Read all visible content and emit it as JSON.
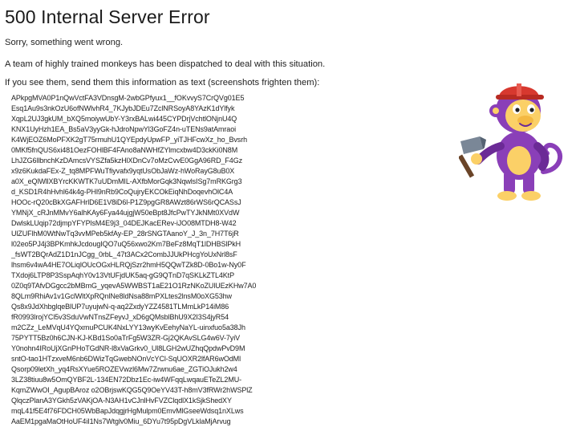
{
  "error": {
    "title": "500 Internal Server Error",
    "line1": "Sorry, something went wrong.",
    "line2": "A team of highly trained monkeys has been dispatched to deal with this situation.",
    "line3": "If you see them, send them this information as text (screenshots frighten them):"
  },
  "trace_lines": [
    "APkpgMVA0P1nQwVctFA3VDnsgM-2wbGPfyux1__fOKvvyS7CrQVg01E5",
    "Esq1Au9s3nkOzU6ofNWlvhR4_7KJybJDEu7ZclNRSoyA8YAzK1dYlfyk",
    "XqpL2UJ3gkUM_bXQ5moiywUbY-Y3rxBALwi445CYPDrjVchtlONjnU4Q",
    "KNX1UyHzh1EA_Bs5aV3yyGk-hJdroNpwYl3GoFZ4n-uTENs9atAmraoi",
    "K4WjEOZ6MoPFXK2gT75rmuhU1QYEpdyUpwFP_yiTJHFcwXz_ho_Bvsrh",
    "0MKf5fnQUS6xi481OezFOHlBF4FAno8aNWHfZYlmcxbw4D3ckKi0N8M",
    "LhJZG6llbnchKzDAmcsVYSZfa5kzHlXDnCv7oMzCvvE0GgA96RD_F4Gz",
    "x9z6KukdaFEx-Z_tq8MPFWuTfiyvafx9yqtUsObJaWz-hWoRayG8uB0X",
    "a0X_eQlWllXBYrcKKWTK7uUDmMIL-AXfbMorGqk3NqwlsISg7mRKGrg3",
    "d_KSD1R4hHvhl64k4g-PHl9nRb9CoQujryEKCOkEiqNhDoqevhOlC4A",
    "HOOc-rQ20cBkXGAFHrlD6E1V8iD6l-P1Z9pgGR8AWzt86rWS6rQCASsJ",
    "YMNjX_cRJnMMvY6alhKAy6Fya44ujgjW50eBpt8JfcPwTYJkNMt0XVdW",
    "DwlskLUqip72djmpYFYPlsM4E9j3_04DEJKacERev-iJO08MTDH8-W42",
    "UlZUFlhM0WtNwTq3vvMPeb5kfAy-EP_28rSNGTAanoY_J_3n_7H7T6jR",
    "l02eo5PJ4j3BPKmhkJcdougIQO7uQ56xwo2Km7BeFz8MqT1lDHBSlPkH",
    "_fsWT2BQrAdZ1D1nJCgg_0rbL_47t3ACx2CombJJUkPHcgYoUxNrl8sF",
    "lhsm6v4wA4HE7OLiqlOUcOGxHLRQjSzr2hmH5QQwTZk8D-0Bo1w-Ny0F",
    "TXdoj6LTP8P3SspAqhY0v13VtUFjdUK5aq-gG9QTnD7qSKLkZTL4KtP",
    "0Z0q9TAfvDGgcc2bMBmG_yqevA5WWBST1aE21O1RzNKoZUlUEzKHw7A0",
    "8QLm9RhiAv1v1GclWltXpRQnlNe8ldNsa88mPXLtes2lnsM0oXG53hw",
    "Qs8x9JdXhbglqeBlUP7uyujwN-q-aq2ZxdyYZZ4581TLMmLkP14iM86",
    "fR0993lrojYCl5v3SduVwNTnsZFeyvJ_xD6gQMsblBhU9X2I3S4jyR54",
    "m2CZz_LeMVqU4YQxmuPCUK4NxLYY13wyKvEehyNaYL-uinxfuo5a38Jh",
    "75PYTT5Bz0h6CJN-KJ-KBd1So0aTrFg5W3ZR-Gj2QKAvSLG4w6V-7yiV",
    "Y0nohn4IRoUjXGnPHoTGdNR-l8xVaGrkv0_Ul8LGH2wUZhqQpdwPvD9M",
    "sntO-tao1HTzxveM6nb6DWizTqGwebNOnVcYCl-SqUOXR2lfAR6wOdMl",
    "Qsorp09letXh_yq4RsXYue5ROZEVwzl6Mw7Zrwnu6ae_ZGTiOJukh2w4",
    "3LZ38tiuu8w5OmQYBF2L-134EN72Dbz1Ec-iw4WFqqLwqauETeZL2MU-",
    "KqmZWwOI_AgupBAroz o2OBrjswKQG5Q9OeYV43T-h8mV3fRWr2hWSPlZ",
    "QlqczPlanA3YGkh5zVAKjOA-N3AH1vCJnlHvFVZClqdlX1kSjkShedXY",
    "mqL41f5E4f76FDCH05WbBapJdqgjrHgMulpm0EmvMlGseeWdsq1nXLws",
    "AaEM1pgaMaOtHoUF4iI1Ns7Wtglv0Miu_6DYu7t95pDgVLklaMjArvug"
  ],
  "monkey": {
    "icon": "monkey-with-hammer-illustration",
    "colors": {
      "body": "#8a3fb8",
      "body_dark": "#6b2a96",
      "face": "#fbd067",
      "hat": "#d7382f",
      "hammer_head": "#7a8797",
      "handle": "#6a4428"
    }
  }
}
